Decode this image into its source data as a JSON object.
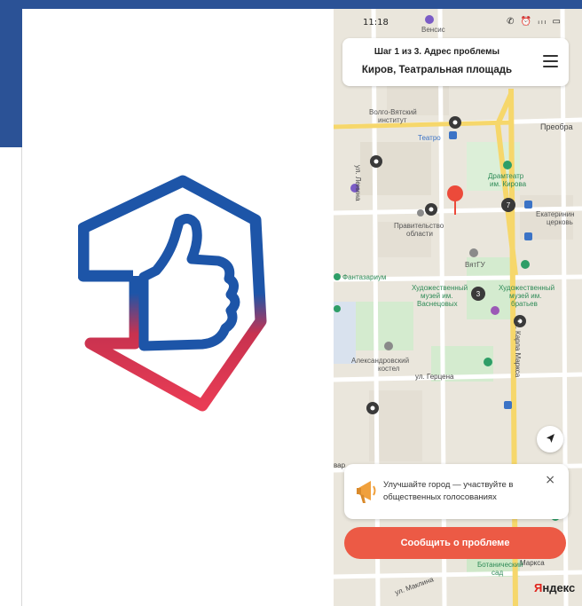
{
  "phone": {
    "status_time": "11:18",
    "status_icons": "✆ ⏰ ᵢₗₗ ▭",
    "header": {
      "step": "Шаг 1 из 3. Адрес проблемы",
      "address": "Киров, Театральная площадь"
    },
    "map_labels": {
      "vensis": "Венсис",
      "volga": "Волго-Вятский",
      "institute": "институт",
      "teatro": "Театро",
      "preobra": "Преобра",
      "dramteatr": "Драмтеатр",
      "kirova": "им. Кирова",
      "ekaterin": "Екатеринин",
      "tserkov": "церковь",
      "pravitelstvo": "Правительство",
      "oblasti": "области",
      "vyatgu": "ВятГУ",
      "fantazarium": "Фантазариум",
      "museum1_a": "Художественный",
      "museum1_b": "музей им.",
      "museum1_c": "Васнецовых",
      "museum2_a": "Художественный",
      "museum2_b": "музей им.",
      "museum2_c": "братьев",
      "kostel_a": "Александровский",
      "kostel_b": "костел",
      "gertsena": "ул. Герцена",
      "lenina": "ул. Ленина",
      "karla_marksa": "ул. Карла Маркса",
      "karla_marksa2": "Маркса",
      "botan_a": "Ботанический",
      "botan_b": "сад",
      "maklina": "ул. Маклина",
      "var": "вар"
    },
    "banner": {
      "text": "Улучшайте город — участвуйте в общественных голосованиях",
      "close_label": "×"
    },
    "report_button": "Сообщить о проблеме",
    "yandex_first": "Я",
    "yandex_rest": "ндекс",
    "cluster_counts": [
      "7",
      "3"
    ]
  }
}
